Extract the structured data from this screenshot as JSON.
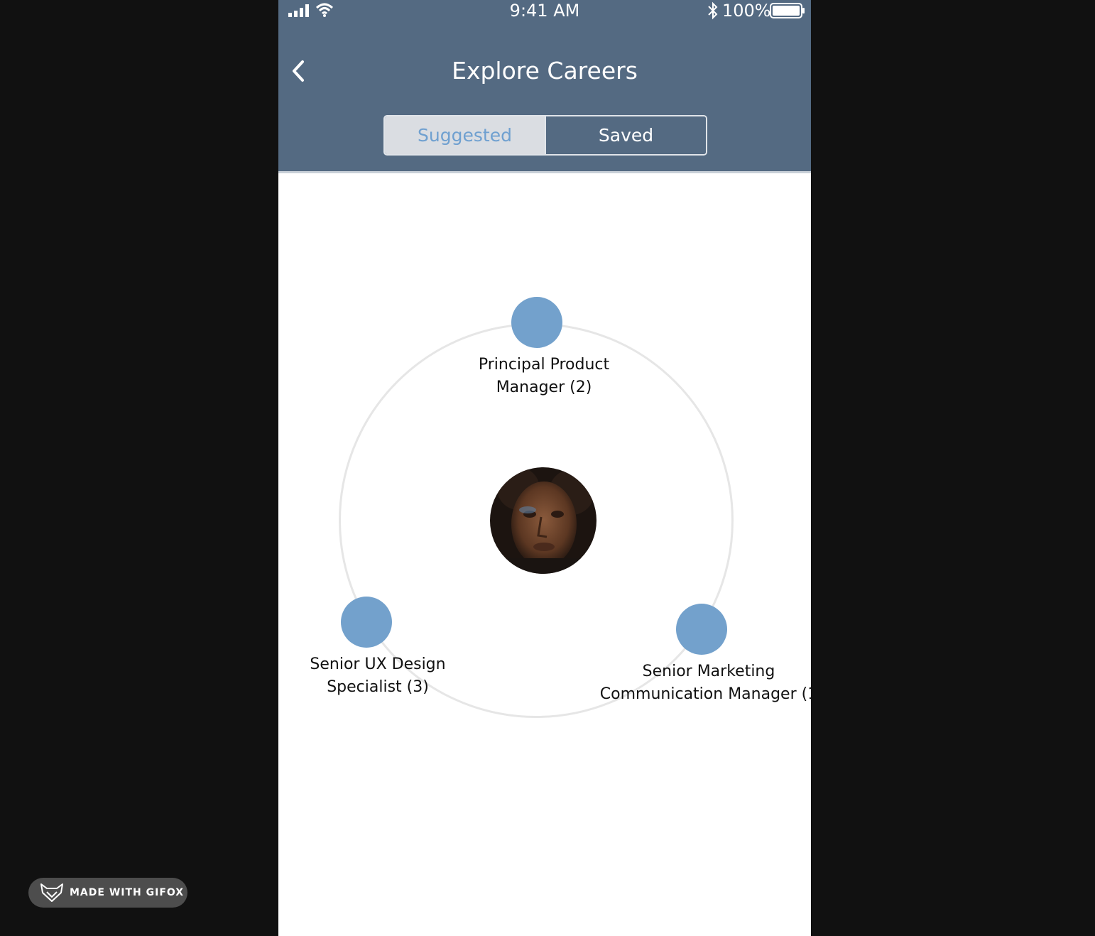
{
  "status_bar": {
    "time": "9:41 AM",
    "battery_percent": "100%",
    "signal_icon": "cellular-signal-icon",
    "wifi_icon": "wifi-icon",
    "bluetooth_icon": "bluetooth-icon",
    "battery_icon": "battery-icon"
  },
  "nav": {
    "title": "Explore Careers",
    "back_icon": "chevron-left-icon"
  },
  "segments": [
    {
      "label": "Suggested",
      "selected": true
    },
    {
      "label": "Saved",
      "selected": false
    }
  ],
  "careers": [
    {
      "line1": "Principal Product",
      "line2": "Manager (2)"
    },
    {
      "line1": "Senior UX Design",
      "line2": "Specialist (3)"
    },
    {
      "line1": "Senior Marketing",
      "line2": "Communication Manager (1"
    }
  ],
  "colors": {
    "header": "#546a82",
    "node": "#73a1cc",
    "segment_selected_text": "#6fa0d0"
  },
  "watermark": {
    "text": "MADE WITH GIFOX",
    "icon": "fox-logo-icon"
  }
}
